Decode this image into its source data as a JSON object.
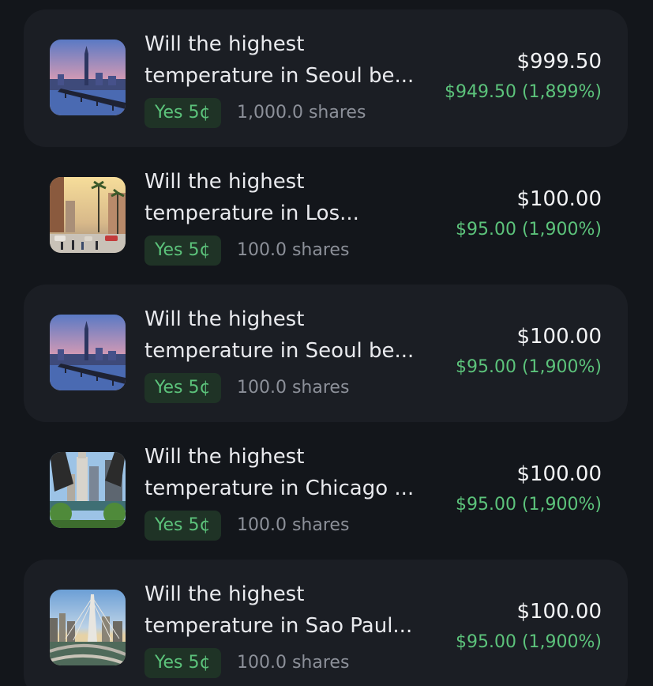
{
  "positions": [
    {
      "title_line1": "Will the highest",
      "title_line2": "temperature in Seoul be...",
      "outcome_badge": "Yes 5¢",
      "shares": "1,000.0 shares",
      "value": "$999.50",
      "gain": "$949.50 (1,899%)",
      "image": "seoul-thumbnail"
    },
    {
      "title_line1": "Will the highest",
      "title_line2": "temperature in Los...",
      "outcome_badge": "Yes 5¢",
      "shares": "100.0 shares",
      "value": "$100.00",
      "gain": "$95.00 (1,900%)",
      "image": "los-angeles-thumbnail"
    },
    {
      "title_line1": "Will the highest",
      "title_line2": "temperature in Seoul be...",
      "outcome_badge": "Yes 5¢",
      "shares": "100.0 shares",
      "value": "$100.00",
      "gain": "$95.00 (1,900%)",
      "image": "seoul-thumbnail"
    },
    {
      "title_line1": "Will the highest",
      "title_line2": "temperature in Chicago ...",
      "outcome_badge": "Yes 5¢",
      "shares": "100.0 shares",
      "value": "$100.00",
      "gain": "$95.00 (1,900%)",
      "image": "chicago-thumbnail"
    },
    {
      "title_line1": "Will the highest",
      "title_line2": "temperature in Sao Paul...",
      "outcome_badge": "Yes 5¢",
      "shares": "100.0 shares",
      "value": "$100.00",
      "gain": "$95.00 (1,900%)",
      "image": "sao-paulo-thumbnail"
    }
  ],
  "colors": {
    "background": "#13161b",
    "card_background": "#1b1e24",
    "positive": "#5cc37b",
    "badge_background": "#1f3326",
    "muted_text": "#8c9099"
  }
}
